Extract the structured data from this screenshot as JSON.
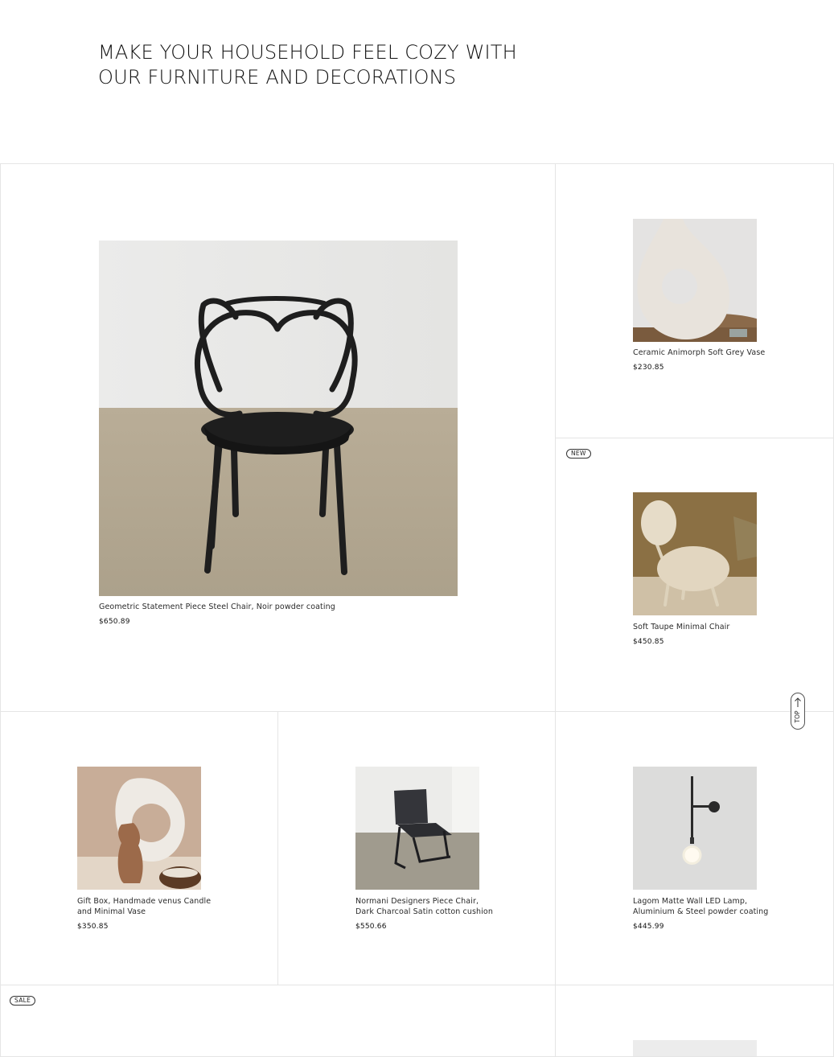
{
  "hero": {
    "line1": "MAKE YOUR HOUSEHOLD FEEL COZY WITH",
    "line2": "OUR FURNITURE AND DECORATIONS"
  },
  "products": [
    {
      "name": "Geometric Statement Piece Steel Chair, Noir powder coating",
      "price": "$650.89",
      "badge": ""
    },
    {
      "name": "Ceramic Animorph Soft Grey Vase",
      "price": "$230.85",
      "badge": ""
    },
    {
      "name": "Soft Taupe Minimal Chair",
      "price": "$450.85",
      "badge": "NEW"
    },
    {
      "name_line1": "Gift Box, Handmade venus Candle",
      "name_line2": "and Minimal Vase",
      "price": "$350.85",
      "badge": ""
    },
    {
      "name_line1": "Normani Designers Piece Chair,",
      "name_line2": "Dark Charcoal Satin cotton cushion",
      "price": "$550.66",
      "badge": ""
    },
    {
      "name_line1": "Lagom Matte Wall LED Lamp,",
      "name_line2": "Aluminium & Steel powder coating",
      "price": "$445.99",
      "badge": ""
    },
    {
      "badge": "SALE"
    }
  ],
  "scroll_top": {
    "label": "TOP",
    "icon": "arrow-up-icon"
  },
  "colors": {
    "border": "#e5e5e5",
    "text": "#1a1a1a",
    "background": "#ffffff"
  }
}
